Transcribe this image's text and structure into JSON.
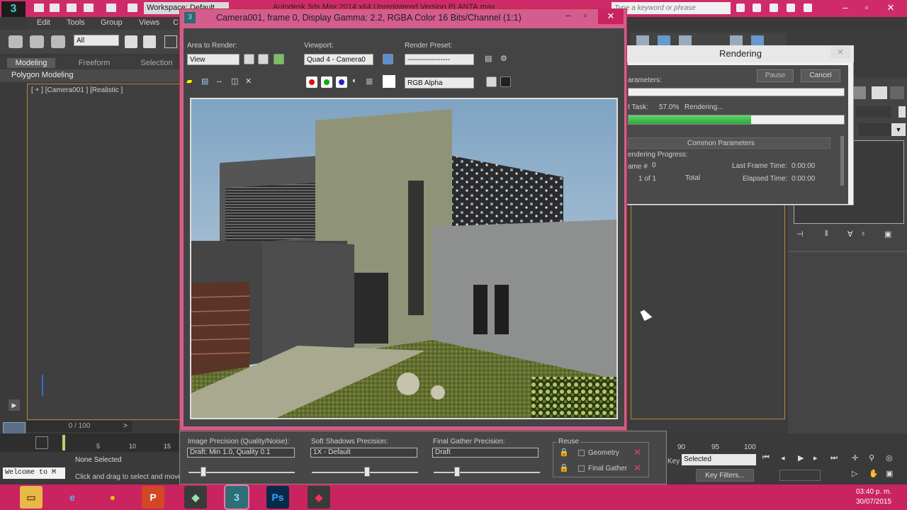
{
  "app": {
    "title": "Autodesk 3ds Max 2014 x64    Unregistered Version    PLANTA.max",
    "workspace": "Workspace: Default",
    "search_placeholder": "Type a keyword or phrase",
    "menus": [
      "Edit",
      "Tools",
      "Group",
      "Views",
      "C"
    ],
    "selection_filter": "All",
    "ribbon_tabs": [
      "Modeling",
      "Freeform",
      "Selection"
    ],
    "ribbon_sub": "Polygon Modeling",
    "viewport_label": "[ + ] [Camera001 ] [Realistic ]",
    "time_slider": "0 / 100",
    "track_ticks_left": [
      "5",
      "10",
      "15"
    ],
    "track_ticks_right": [
      "90",
      "95",
      "100"
    ],
    "status_none_selected": "None Selected",
    "status_hint": "Click and drag to select and move objects",
    "maxscript": "Welcome to M",
    "selected_dropdown": "Selected",
    "key_filters": "Key Filters...",
    "key_prefix": "Key"
  },
  "frame_window": {
    "title": "Camera001, frame 0, Display Gamma: 2.2, RGBA Color 16 Bits/Channel (1:1)",
    "area_label": "Area to Render:",
    "area_value": "View",
    "viewport_label": "Viewport:",
    "viewport_value": "Quad 4 - Camera0",
    "preset_label": "Render Preset:",
    "preset_value": "------------------",
    "channel_value": "RGB Alpha"
  },
  "render_settings": {
    "image_precision_label": "Image Precision (Quality/Noise):",
    "image_precision_value": "Draft: Min 1.0, Quality 0.1",
    "soft_shadows_label": "Soft Shadows Precision:",
    "soft_shadows_value": "1X - Default",
    "final_gather_label": "Final Gather Precision:",
    "final_gather_value": "Draft",
    "reuse_label": "Reuse",
    "reuse_geometry": "Geometry",
    "reuse_final_gather": "Final Gather",
    "image_precision_level": 0.14,
    "soft_shadows_level": 0.52,
    "final_gather_level": 0.22
  },
  "rendering_dialog": {
    "title": "Rendering",
    "pause": "Pause",
    "cancel": "Cancel",
    "parameter_label": "arameters:",
    "task_label": "t Task:",
    "task_percent": "57.0%",
    "task_status": "Rendering...",
    "progress": 0.57,
    "section": "Common Parameters",
    "rendering_progress": "endering Progress:",
    "frame_label": "ame #",
    "frame_value": "0",
    "of_value": "1 of 1",
    "total_label": "Total",
    "last_frame_label": "Last Frame Time:",
    "last_frame_value": "0:00:00",
    "elapsed_label": "Elapsed Time:",
    "elapsed_value": "0:00:00"
  },
  "taskbar": {
    "time": "03:40 p. m.",
    "date": "30/07/2015",
    "apps": [
      {
        "name": "file-explorer-icon",
        "glyph": "▭",
        "bg": "#e8b84a",
        "fg": "#6b4b00"
      },
      {
        "name": "internet-explorer-icon",
        "glyph": "e",
        "bg": "#c9245f",
        "fg": "#5ab0ff"
      },
      {
        "name": "chrome-icon",
        "glyph": "●",
        "bg": "#c9245f",
        "fg": "#f4c20d"
      },
      {
        "name": "powerpoint-icon",
        "glyph": "P",
        "bg": "#d24726",
        "fg": "#ffffff"
      },
      {
        "name": "3dsmax-icon",
        "glyph": "◆",
        "bg": "#3a3a3a",
        "fg": "#9adfb0"
      },
      {
        "name": "3dsmax-active-icon",
        "glyph": "3",
        "bg": "#2f6e76",
        "fg": "#9df"
      },
      {
        "name": "photoshop-icon",
        "glyph": "Ps",
        "bg": "#0a2a4a",
        "fg": "#31a8ff"
      },
      {
        "name": "sketchup-icon",
        "glyph": "◆",
        "bg": "#3a3a3a",
        "fg": "#e35"
      }
    ]
  }
}
